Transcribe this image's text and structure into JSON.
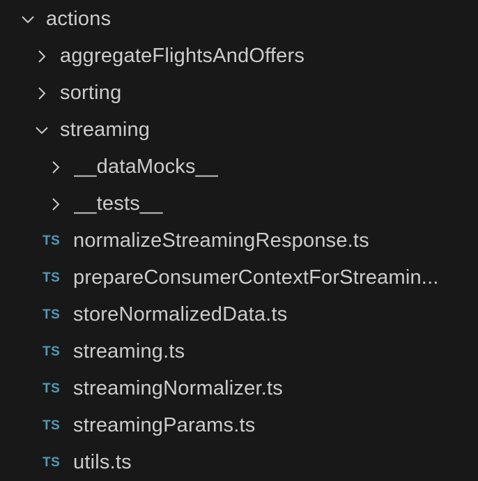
{
  "explorer": {
    "accent_colors": {
      "background": "#181818",
      "text": "#cccccc",
      "ts_icon": "#519aba",
      "chevron": "#cccccc"
    },
    "rows": [
      {
        "kind": "folder",
        "depth": 0,
        "expanded": true,
        "label": "actions"
      },
      {
        "kind": "folder",
        "depth": 1,
        "expanded": false,
        "label": "aggregateFlightsAndOffers"
      },
      {
        "kind": "folder",
        "depth": 1,
        "expanded": false,
        "label": "sorting"
      },
      {
        "kind": "folder",
        "depth": 1,
        "expanded": true,
        "label": "streaming"
      },
      {
        "kind": "folder",
        "depth": 2,
        "expanded": false,
        "label": "__dataMocks__"
      },
      {
        "kind": "folder",
        "depth": 2,
        "expanded": false,
        "label": "__tests__"
      },
      {
        "kind": "file",
        "depth": 2,
        "icon": "TS",
        "label": "normalizeStreamingResponse.ts"
      },
      {
        "kind": "file",
        "depth": 2,
        "icon": "TS",
        "label": "prepareConsumerContextForStreamin..."
      },
      {
        "kind": "file",
        "depth": 2,
        "icon": "TS",
        "label": "storeNormalizedData.ts"
      },
      {
        "kind": "file",
        "depth": 2,
        "icon": "TS",
        "label": "streaming.ts"
      },
      {
        "kind": "file",
        "depth": 2,
        "icon": "TS",
        "label": "streamingNormalizer.ts"
      },
      {
        "kind": "file",
        "depth": 2,
        "icon": "TS",
        "label": "streamingParams.ts"
      },
      {
        "kind": "file",
        "depth": 2,
        "icon": "TS",
        "label": "utils.ts"
      }
    ]
  }
}
